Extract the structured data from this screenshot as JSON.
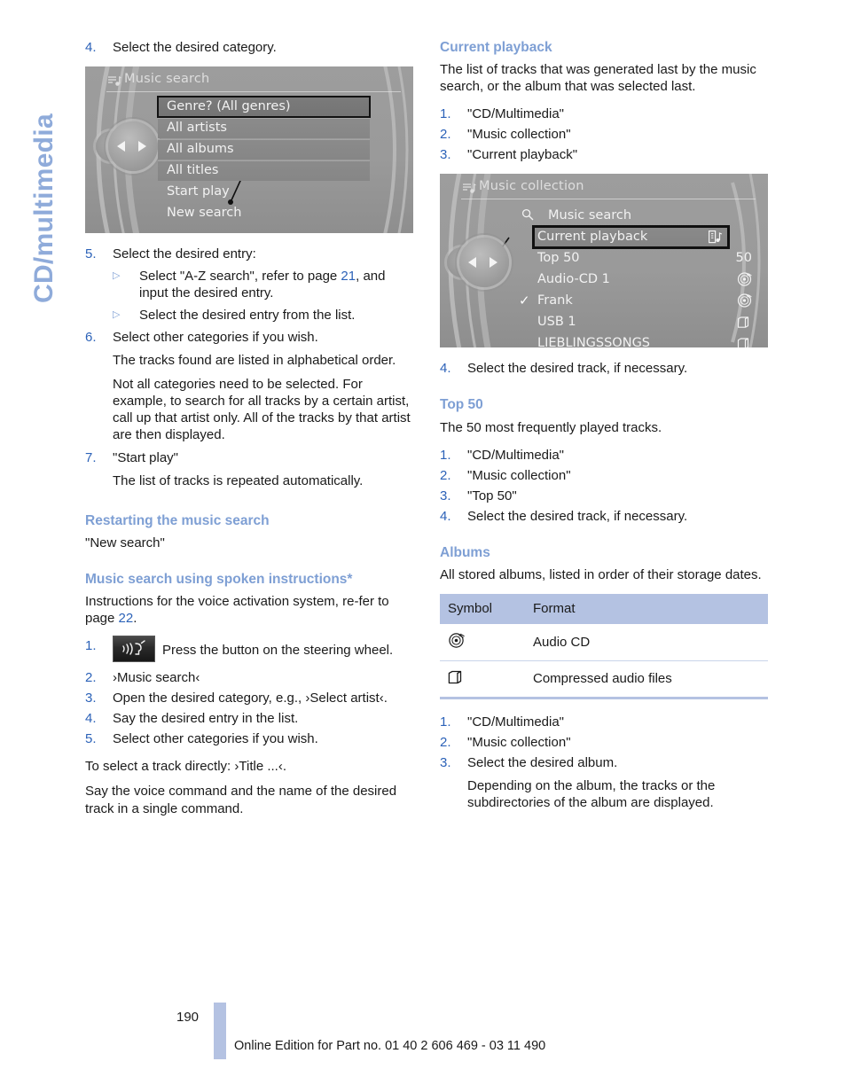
{
  "chapter_tab": {
    "label": "CD/multimedia"
  },
  "left_column": {
    "step4": {
      "num": "4.",
      "text": "Select the desired category."
    },
    "screenshot_music_search": {
      "title": "Music search",
      "title_icon": "music-note-icon",
      "items": [
        {
          "label": "Genre? (All genres)",
          "style": "selected"
        },
        {
          "label": "All artists",
          "style": "bar"
        },
        {
          "label": "All albums",
          "style": "bar"
        },
        {
          "label": "All titles",
          "style": "bar"
        },
        {
          "label": "Start play",
          "style": "plain"
        },
        {
          "label": "New search",
          "style": "plain"
        }
      ]
    },
    "step5": {
      "num": "5.",
      "text": "Select the desired entry:"
    },
    "step5_bullets": [
      {
        "text_a": "Select \"A-Z search\", refer to page ",
        "page": "21",
        "text_b": ", and input the desired entry."
      },
      {
        "text_a": "Select the desired entry from the list.",
        "page": "",
        "text_b": ""
      }
    ],
    "step6": {
      "num": "6.",
      "text": "Select other categories if you wish."
    },
    "step6_note1": "The tracks found are listed in alphabetical order.",
    "step6_note2": "Not all categories need to be selected. For example, to search for all tracks by a certain artist, call up that artist only. All of the tracks by that artist are then displayed.",
    "step7": {
      "num": "7.",
      "text": "\"Start play\""
    },
    "step7_note": "The list of tracks is repeated automatically.",
    "heading_restarting": "Restarting the music search",
    "restarting_text": "\"New search\"",
    "heading_spoken": "Music search using spoken instructions*",
    "spoken_intro_a": "Instructions for the voice activation system, re-fer to page ",
    "spoken_intro_page": "22",
    "spoken_intro_b": ".",
    "spoken_steps": [
      {
        "num": "1.",
        "icon": "voice-button-icon",
        "text": "Press the button on the steering wheel."
      },
      {
        "num": "2.",
        "icon": "",
        "text": "›Music search‹"
      },
      {
        "num": "3.",
        "icon": "",
        "text": "Open the desired category, e.g., ›Select artist‹."
      },
      {
        "num": "4.",
        "icon": "",
        "text": "Say the desired entry in the list."
      },
      {
        "num": "5.",
        "icon": "",
        "text": "Select other categories if you wish."
      }
    ],
    "closing_1": "To select a track directly: ›Title ...‹.",
    "closing_2": "Say the voice command and the name of the desired track in a single command."
  },
  "right_column": {
    "heading_current_playback": "Current playback",
    "current_playback_text": "The list of tracks that was generated last by the music search, or the album that was selected last.",
    "current_playback_steps": [
      {
        "num": "1.",
        "text": "\"CD/Multimedia\""
      },
      {
        "num": "2.",
        "text": "\"Music collection\""
      },
      {
        "num": "3.",
        "text": "\"Current playback\""
      }
    ],
    "screenshot_music_collection": {
      "title": "Music collection",
      "title_icon": "music-note-icon",
      "items": [
        {
          "label": "Music search",
          "icon": "",
          "lead": "search-icon",
          "style": "plain"
        },
        {
          "label": "Current playback",
          "icon": "now-playing-icon",
          "lead": "",
          "style": "selected"
        },
        {
          "label": "Top 50",
          "icon": "50",
          "lead": "",
          "style": "plain"
        },
        {
          "label": "Audio-CD 1",
          "icon": "cd-disc-icon",
          "lead": "",
          "style": "plain"
        },
        {
          "label": "Frank",
          "icon": "cd-disc-icon",
          "lead": "check",
          "style": "plain"
        },
        {
          "label": "USB 1",
          "icon": "folder-icon",
          "lead": "",
          "style": "plain"
        },
        {
          "label": "LIEBLINGSSONGS",
          "icon": "folder-icon",
          "lead": "",
          "style": "plain"
        }
      ]
    },
    "current_playback_step4": {
      "num": "4.",
      "text": "Select the desired track, if necessary."
    },
    "heading_top50": "Top 50",
    "top50_text": "The 50 most frequently played tracks.",
    "top50_steps": [
      {
        "num": "1.",
        "text": "\"CD/Multimedia\""
      },
      {
        "num": "2.",
        "text": "\"Music collection\""
      },
      {
        "num": "3.",
        "text": "\"Top 50\""
      },
      {
        "num": "4.",
        "text": "Select the desired track, if necessary."
      }
    ],
    "heading_albums": "Albums",
    "albums_text": "All stored albums, listed in order of their storage dates.",
    "symbol_table": {
      "headers": [
        "Symbol",
        "Format"
      ],
      "rows": [
        {
          "icon": "cd-disc-icon",
          "format": "Audio CD"
        },
        {
          "icon": "folder-icon",
          "format": "Compressed audio files"
        }
      ]
    },
    "albums_steps": [
      {
        "num": "1.",
        "text": "\"CD/Multimedia\""
      },
      {
        "num": "2.",
        "text": "\"Music collection\""
      },
      {
        "num": "3.",
        "text": "Select the desired album."
      }
    ],
    "albums_note": "Depending on the album, the tracks or the subdirectories of the album are displayed."
  },
  "footer": {
    "page_number": "190",
    "text": "Online Edition for Part no. 01 40 2 606 469 - 03 11 490"
  },
  "colors": {
    "heading_blue": "#7e9fd4",
    "number_blue": "#2c62b8",
    "tab_blue": "#8fabda",
    "table_header": "#b4c2e2"
  }
}
